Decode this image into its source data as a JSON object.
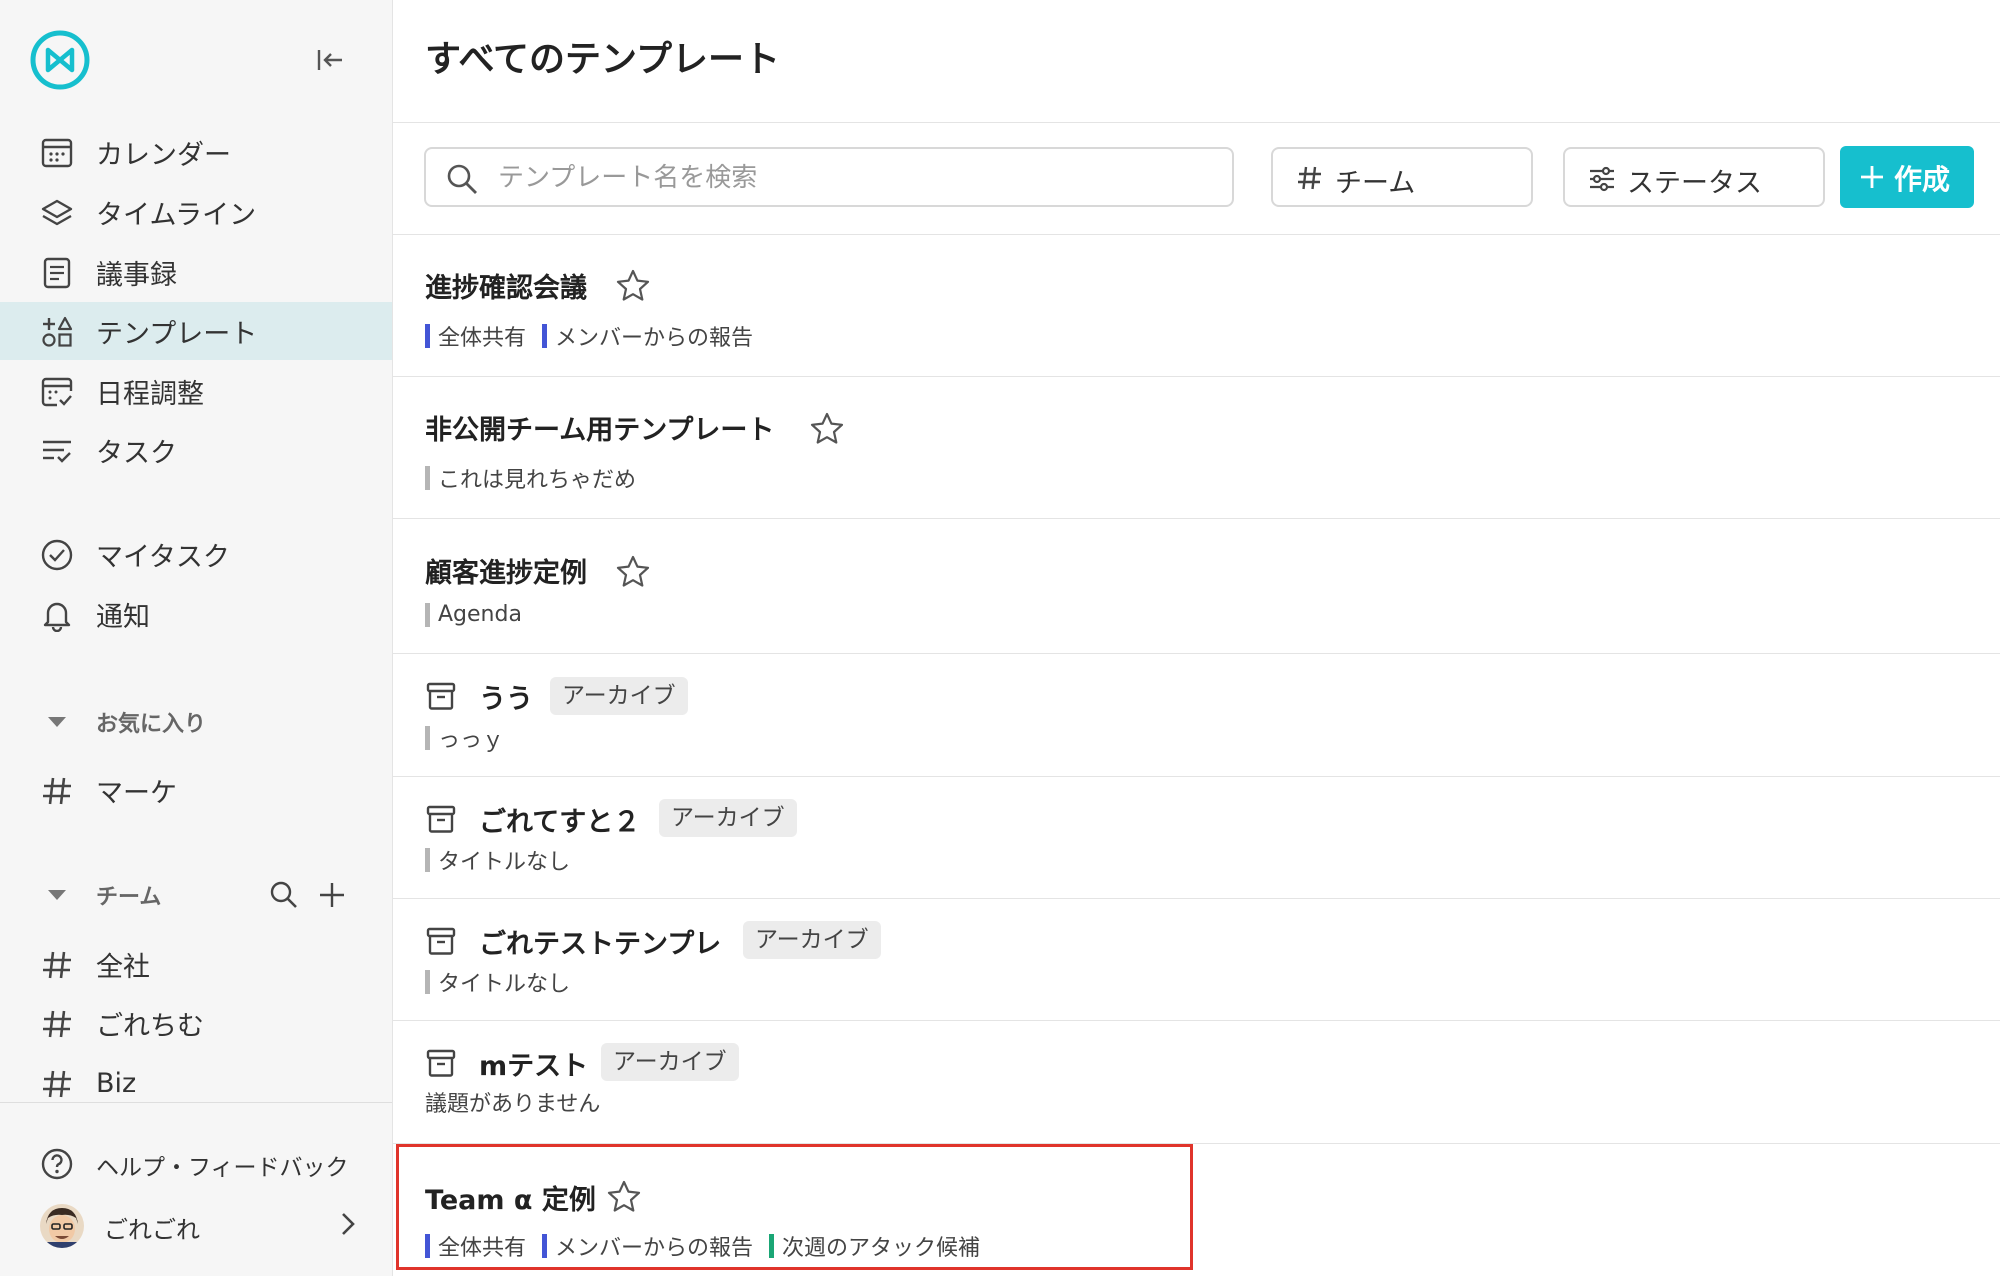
{
  "sidebar": {
    "collapse_icon": "collapse-left-icon",
    "nav": [
      {
        "label": "カレンダー",
        "icon": "calendar-icon"
      },
      {
        "label": "タイムライン",
        "icon": "layers-icon"
      },
      {
        "label": "議事録",
        "icon": "document-icon"
      },
      {
        "label": "テンプレート",
        "icon": "template-icon",
        "active": true
      },
      {
        "label": "日程調整",
        "icon": "schedule-check-icon"
      },
      {
        "label": "タスク",
        "icon": "task-list-icon"
      }
    ],
    "personal": [
      {
        "label": "マイタスク",
        "icon": "check-circle-icon"
      },
      {
        "label": "通知",
        "icon": "bell-icon"
      }
    ],
    "favorites": {
      "label": "お気に入り",
      "items": [
        {
          "label": "マーケ"
        }
      ]
    },
    "teams": {
      "label": "チーム",
      "items": [
        {
          "label": "全社"
        },
        {
          "label": "ごれちむ"
        },
        {
          "label": "Biz"
        }
      ]
    },
    "help_label": "ヘルプ・フィードバック",
    "user_name": "ごれごれ"
  },
  "main": {
    "title": "すべてのテンプレート",
    "search_placeholder": "テンプレート名を検索",
    "team_filter_label": "チーム",
    "status_filter_label": "ステータス",
    "create_label": "作成"
  },
  "colors": {
    "accent": "#16bfce",
    "active_nav": "#dcecee",
    "tag_blue": "#4355d6",
    "tag_gray": "#b5b5b5",
    "tag_green": "#1aa675",
    "highlight": "#e0342b"
  },
  "templates": [
    {
      "title": "進捗確認会議",
      "archived": false,
      "tags": [
        {
          "label": "全体共有",
          "color": "#4355d6"
        },
        {
          "label": "メンバーからの報告",
          "color": "#4355d6"
        }
      ]
    },
    {
      "title": "非公開チーム用テンプレート",
      "archived": false,
      "tags": [
        {
          "label": "これは見れちゃだめ",
          "color": "#b5b5b5"
        }
      ]
    },
    {
      "title": "顧客進捗定例",
      "archived": false,
      "tags": [
        {
          "label": "Agenda",
          "color": "#b5b5b5"
        }
      ]
    },
    {
      "title": "うう",
      "archived": true,
      "badge": "アーカイブ",
      "tags": [
        {
          "label": "っっｙ",
          "color": "#b5b5b5"
        }
      ]
    },
    {
      "title": "ごれてすと２",
      "archived": true,
      "badge": "アーカイブ",
      "tags": [
        {
          "label": "タイトルなし",
          "color": "#b5b5b5"
        }
      ]
    },
    {
      "title": "ごれテストテンプレ",
      "archived": true,
      "badge": "アーカイブ",
      "tags": [
        {
          "label": "タイトルなし",
          "color": "#b5b5b5"
        }
      ]
    },
    {
      "title": "mテスト",
      "archived": true,
      "badge": "アーカイブ",
      "note": "議題がありません"
    },
    {
      "title": "Team α 定例",
      "archived": false,
      "highlighted": true,
      "tags": [
        {
          "label": "全体共有",
          "color": "#4355d6"
        },
        {
          "label": "メンバーからの報告",
          "color": "#4355d6"
        },
        {
          "label": "次週のアタック候補",
          "color": "#1aa675"
        }
      ]
    }
  ]
}
